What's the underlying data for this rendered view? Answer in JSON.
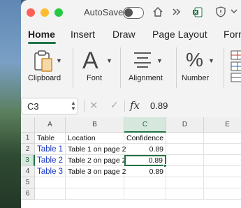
{
  "titlebar": {
    "autosave_label": "AutoSave"
  },
  "ribbon_tabs": [
    "Home",
    "Insert",
    "Draw",
    "Page Layout",
    "Form"
  ],
  "ribbon_groups": {
    "clipboard": "Clipboard",
    "font": "Font",
    "alignment": "Alignment",
    "number": "Number",
    "font_glyph": "A",
    "number_glyph": "%"
  },
  "formula_bar": {
    "cell_ref": "C3",
    "fx_label": "fx",
    "value": "0.89"
  },
  "columns": [
    "A",
    "B",
    "C",
    "D",
    "E"
  ],
  "rows": [
    "1",
    "2",
    "3",
    "4",
    "5",
    "6"
  ],
  "cells": {
    "A1": "Table",
    "B1": "Location",
    "C1": "Confidence",
    "A2": "Table 1",
    "B2": "Table 1 on page 2",
    "C2": "0.89",
    "A3": "Table 2",
    "B3": "Table 2 on page 2",
    "C3": "0.89",
    "A4": "Table 3",
    "B4": "Table 3 on page 2",
    "C4": "0.89"
  },
  "selection": {
    "active_cell": "C3",
    "column": "C",
    "row": "3"
  },
  "colors": {
    "excel_green": "#217346",
    "link_blue": "#1a37c7"
  }
}
